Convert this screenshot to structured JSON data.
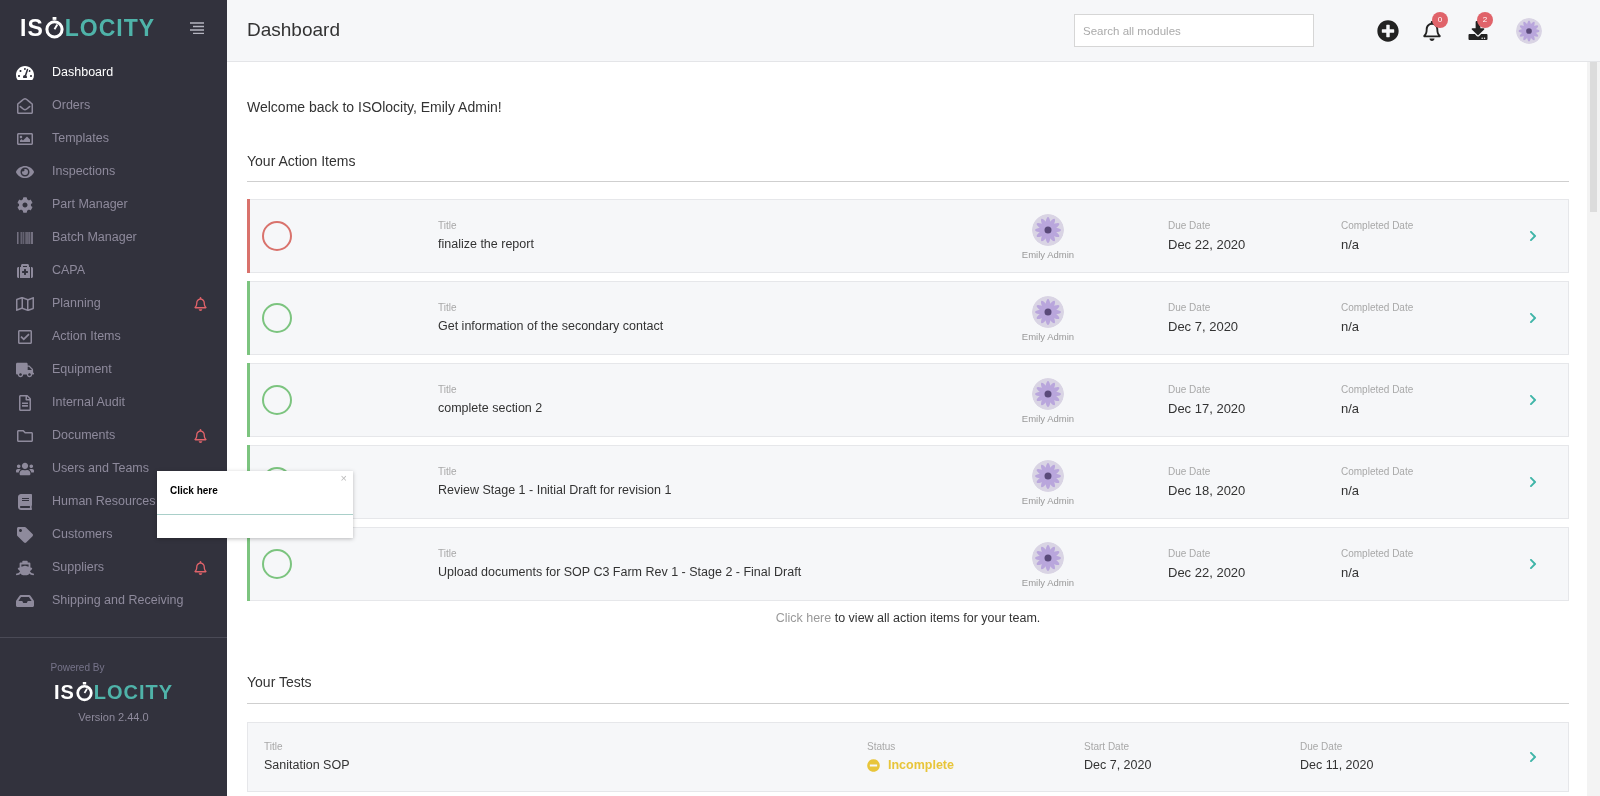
{
  "logo": {
    "left": "IS",
    "right": "LOCITY"
  },
  "sidebar": {
    "items": [
      {
        "label": "Dashboard",
        "selected": true,
        "alert": false
      },
      {
        "label": "Orders",
        "selected": false,
        "alert": false
      },
      {
        "label": "Templates",
        "selected": false,
        "alert": false
      },
      {
        "label": "Inspections",
        "selected": false,
        "alert": false
      },
      {
        "label": "Part Manager",
        "selected": false,
        "alert": false
      },
      {
        "label": "Batch Manager",
        "selected": false,
        "alert": false
      },
      {
        "label": "CAPA",
        "selected": false,
        "alert": false
      },
      {
        "label": "Planning",
        "selected": false,
        "alert": true
      },
      {
        "label": "Action Items",
        "selected": false,
        "alert": false
      },
      {
        "label": "Equipment",
        "selected": false,
        "alert": false
      },
      {
        "label": "Internal Audit",
        "selected": false,
        "alert": false
      },
      {
        "label": "Documents",
        "selected": false,
        "alert": true
      },
      {
        "label": "Users and Teams",
        "selected": false,
        "alert": false
      },
      {
        "label": "Human Resources",
        "selected": false,
        "alert": false
      },
      {
        "label": "Customers",
        "selected": false,
        "alert": false
      },
      {
        "label": "Suppliers",
        "selected": false,
        "alert": true
      },
      {
        "label": "Shipping and Receiving",
        "selected": false,
        "alert": false
      }
    ],
    "powered_by": "Powered By",
    "footer_logo": {
      "left": "IS",
      "right": "LOCITY"
    },
    "version": "Version 2.44.0"
  },
  "header": {
    "title": "Dashboard",
    "search": {
      "placeholder": "Search all modules"
    },
    "notifications_badge": "0",
    "downloads_badge": "2"
  },
  "welcome": "Welcome back to ISOlocity, Emily Admin!",
  "action_items": {
    "heading": "Your Action Items",
    "items": [
      {
        "title_label": "Title",
        "title": "finalize the report",
        "assignee": "Emily Admin",
        "due_label": "Due Date",
        "due": "Dec 22, 2020",
        "completed_label": "Completed Date",
        "completed": "n/a",
        "color": "#d9726c"
      },
      {
        "title_label": "Title",
        "title": "Get information of the secondary contact",
        "assignee": "Emily Admin",
        "due_label": "Due Date",
        "due": "Dec 7, 2020",
        "completed_label": "Completed Date",
        "completed": "n/a",
        "color": "#7cc47f"
      },
      {
        "title_label": "Title",
        "title": "complete section 2",
        "assignee": "Emily Admin",
        "due_label": "Due Date",
        "due": "Dec 17, 2020",
        "completed_label": "Completed Date",
        "completed": "n/a",
        "color": "#7cc47f"
      },
      {
        "title_label": "Title",
        "title": "Review Stage 1 - Initial Draft for revision 1",
        "assignee": "Emily Admin",
        "due_label": "Due Date",
        "due": "Dec 18, 2020",
        "completed_label": "Completed Date",
        "completed": "n/a",
        "color": "#7cc47f"
      },
      {
        "title_label": "Title",
        "title": "Upload documents for SOP C3 Farm Rev 1 - Stage 2 - Final Draft",
        "assignee": "Emily Admin",
        "due_label": "Due Date",
        "due": "Dec 22, 2020",
        "completed_label": "Completed Date",
        "completed": "n/a",
        "color": "#7cc47f"
      }
    ],
    "footer_link": "Click here",
    "footer_text": "to view all action items for your team."
  },
  "tests": {
    "heading": "Your Tests",
    "items": [
      {
        "title_label": "Title",
        "title": "Sanitation SOP",
        "status_label": "Status",
        "status": "Incomplete",
        "start_label": "Start Date",
        "start": "Dec 7, 2020",
        "due_label": "Due Date",
        "due": "Dec 11, 2020"
      }
    ]
  },
  "tooltip": {
    "text": "Click here",
    "close": "×"
  }
}
